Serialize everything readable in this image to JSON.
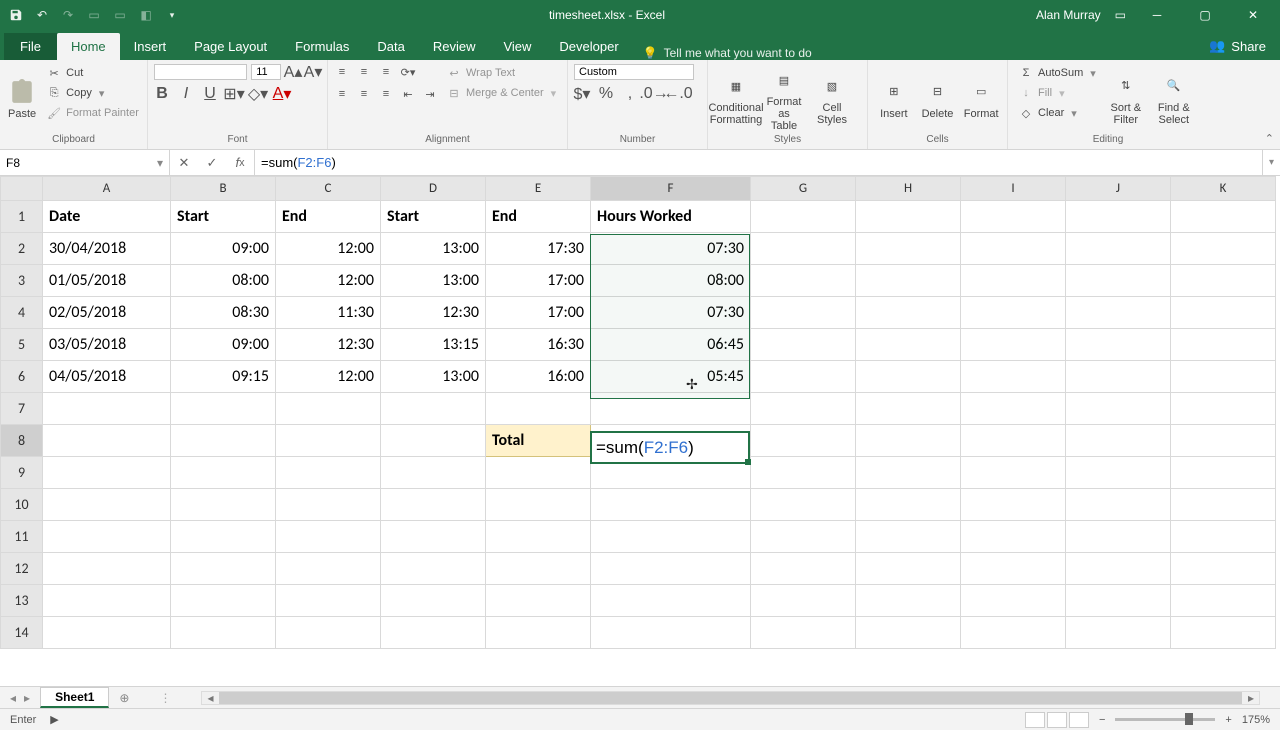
{
  "title_bar": {
    "filename": "timesheet.xlsx - Excel",
    "user": "Alan Murray"
  },
  "tabs": {
    "file": "File",
    "home": "Home",
    "insert": "Insert",
    "page_layout": "Page Layout",
    "formulas": "Formulas",
    "data": "Data",
    "review": "Review",
    "view": "View",
    "developer": "Developer",
    "tell_me": "Tell me what you want to do",
    "share": "Share"
  },
  "ribbon": {
    "clipboard": {
      "label": "Clipboard",
      "paste": "Paste",
      "cut": "Cut",
      "copy": "Copy",
      "format_painter": "Format Painter"
    },
    "font": {
      "label": "Font",
      "size": "11"
    },
    "alignment": {
      "label": "Alignment",
      "wrap": "Wrap Text",
      "merge": "Merge & Center"
    },
    "number": {
      "label": "Number",
      "format": "Custom"
    },
    "styles": {
      "label": "Styles",
      "cond": "Conditional Formatting",
      "fat": "Format as Table",
      "cell": "Cell Styles"
    },
    "cells": {
      "label": "Cells",
      "insert": "Insert",
      "delete": "Delete",
      "format": "Format"
    },
    "editing": {
      "label": "Editing",
      "autosum": "AutoSum",
      "fill": "Fill",
      "clear": "Clear",
      "sort": "Sort & Filter",
      "find": "Find & Select"
    }
  },
  "name_box": "F8",
  "formula": {
    "prefix": "=sum(",
    "ref": "F2:F6",
    "suffix": ")"
  },
  "columns": [
    "A",
    "B",
    "C",
    "D",
    "E",
    "F",
    "G",
    "H",
    "I",
    "J",
    "K"
  ],
  "row_numbers": [
    "1",
    "2",
    "3",
    "4",
    "5",
    "6",
    "7",
    "8",
    "9",
    "10",
    "11",
    "12",
    "13",
    "14"
  ],
  "headers": {
    "A": "Date",
    "B": "Start",
    "C": "End",
    "D": "Start",
    "E": "End",
    "F": "Hours Worked"
  },
  "rows": [
    {
      "date": "30/04/2018",
      "b": "09:00",
      "c": "12:00",
      "d": "13:00",
      "e": "17:30",
      "f": "07:30"
    },
    {
      "date": "01/05/2018",
      "b": "08:00",
      "c": "12:00",
      "d": "13:00",
      "e": "17:00",
      "f": "08:00"
    },
    {
      "date": "02/05/2018",
      "b": "08:30",
      "c": "11:30",
      "d": "12:30",
      "e": "17:00",
      "f": "07:30"
    },
    {
      "date": "03/05/2018",
      "b": "09:00",
      "c": "12:30",
      "d": "13:15",
      "e": "16:30",
      "f": "06:45"
    },
    {
      "date": "04/05/2018",
      "b": "09:15",
      "c": "12:00",
      "d": "13:00",
      "e": "16:00",
      "f": "05:45"
    }
  ],
  "total_label": "Total",
  "sheet_tab": "Sheet1",
  "status": {
    "mode": "Enter",
    "zoom": "175%"
  }
}
